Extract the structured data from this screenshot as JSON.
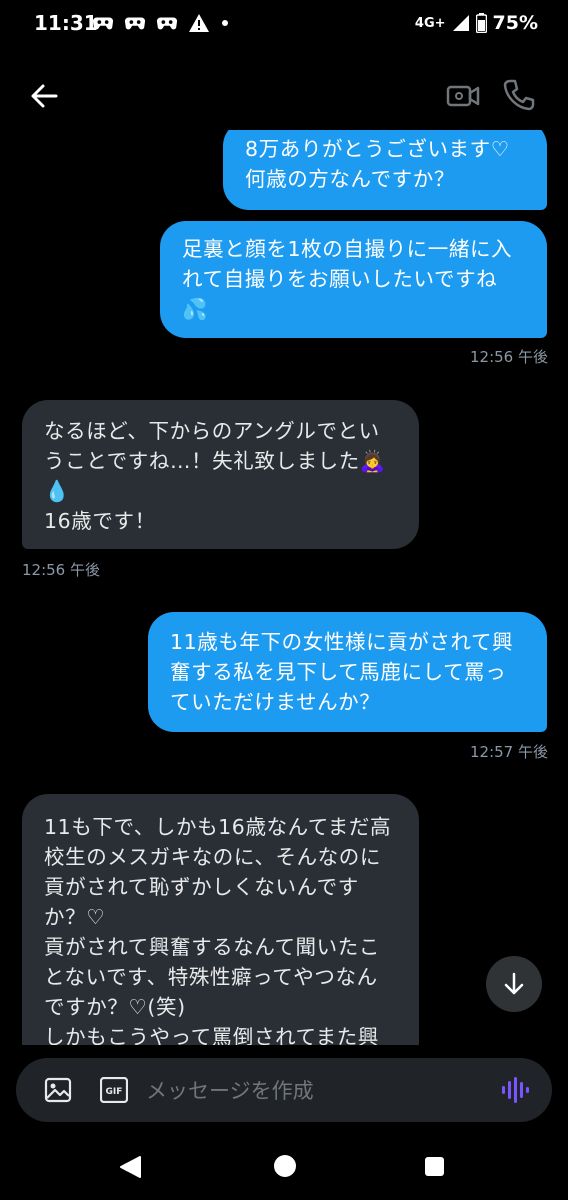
{
  "status_bar": {
    "time": "11:31",
    "network": "4G+",
    "battery": "75%"
  },
  "messages": [
    {
      "direction": "sent",
      "text": "8万ありがとうございます♡\n何歳の方なんですか？"
    },
    {
      "direction": "sent",
      "text": "足裏と顔を1枚の自撮りに一緒に入\nれて自撮りをお願いしたいですね\n💦",
      "time": "12:56 午後"
    },
    {
      "direction": "received",
      "text": "なるほど、下からのアングルでとい\nうことですね…！失礼致しました🙇‍♀️\n💧\n16歳です！",
      "time": "12:56 午後"
    },
    {
      "direction": "sent",
      "text": "11歳も年下の女性様に貢がされて興\n奮する私を見下して馬鹿にして罵っ\nていただけませんか？",
      "time": "12:57 午後"
    },
    {
      "direction": "received",
      "text": "11も下で、しかも16歳なんてまだ高\n校生のメスガキなのに、そんなのに\n貢がされて恥ずかしくないんです\nか？♡\n貢がされて興奮するなんて聞いたこ\nとないです、特殊性癖ってやつなん\nですか？♡(笑)\nしかもこうやって罵倒されてまた興"
    }
  ],
  "composer": {
    "placeholder": "メッセージを作成",
    "gif_label": "GIF"
  },
  "colors": {
    "sent_bubble": "#1d9bf0",
    "received_bubble": "#2a2f35",
    "background": "#000000",
    "voice_accent": "#7856ff"
  }
}
